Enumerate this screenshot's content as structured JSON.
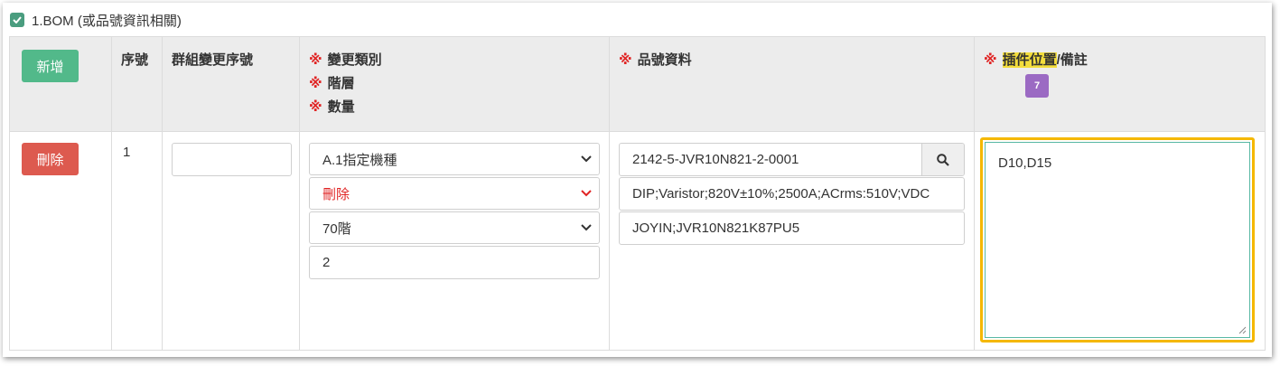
{
  "section": {
    "title": "1.BOM (或品號資訊相關)"
  },
  "header": {
    "add_label": "新增",
    "seq_label": "序號",
    "group_label": "群組變更序號",
    "required_mark": "※",
    "change_lines": [
      "變更類別",
      "階層",
      "數量"
    ],
    "part_info_label": "品號資料",
    "position_highlight": "插件位置",
    "remark_suffix": "/備註",
    "badge_count": "7"
  },
  "row": {
    "delete_label": "刪除",
    "seq": "1",
    "group_seq_value": "",
    "change_type_value": "A.1指定機種",
    "action_value": "刪除",
    "level_value": "70階",
    "qty_value": "2",
    "part_no_value": "2142-5-JVR10N821-2-0001",
    "part_desc_value": "DIP;Varistor;820V±10%;2500A;ACrms:510V;VDC",
    "part_spec_value": "JOYIN;JVR10N821K87PU5",
    "remark_value": "D10,D15"
  },
  "colors": {
    "add": "#52b98a",
    "delete": "#dd5a4f",
    "required": "#e02424",
    "highlight": "#f3dd3c",
    "badge": "#9b6ac3",
    "focus_border": "#f5b800"
  }
}
